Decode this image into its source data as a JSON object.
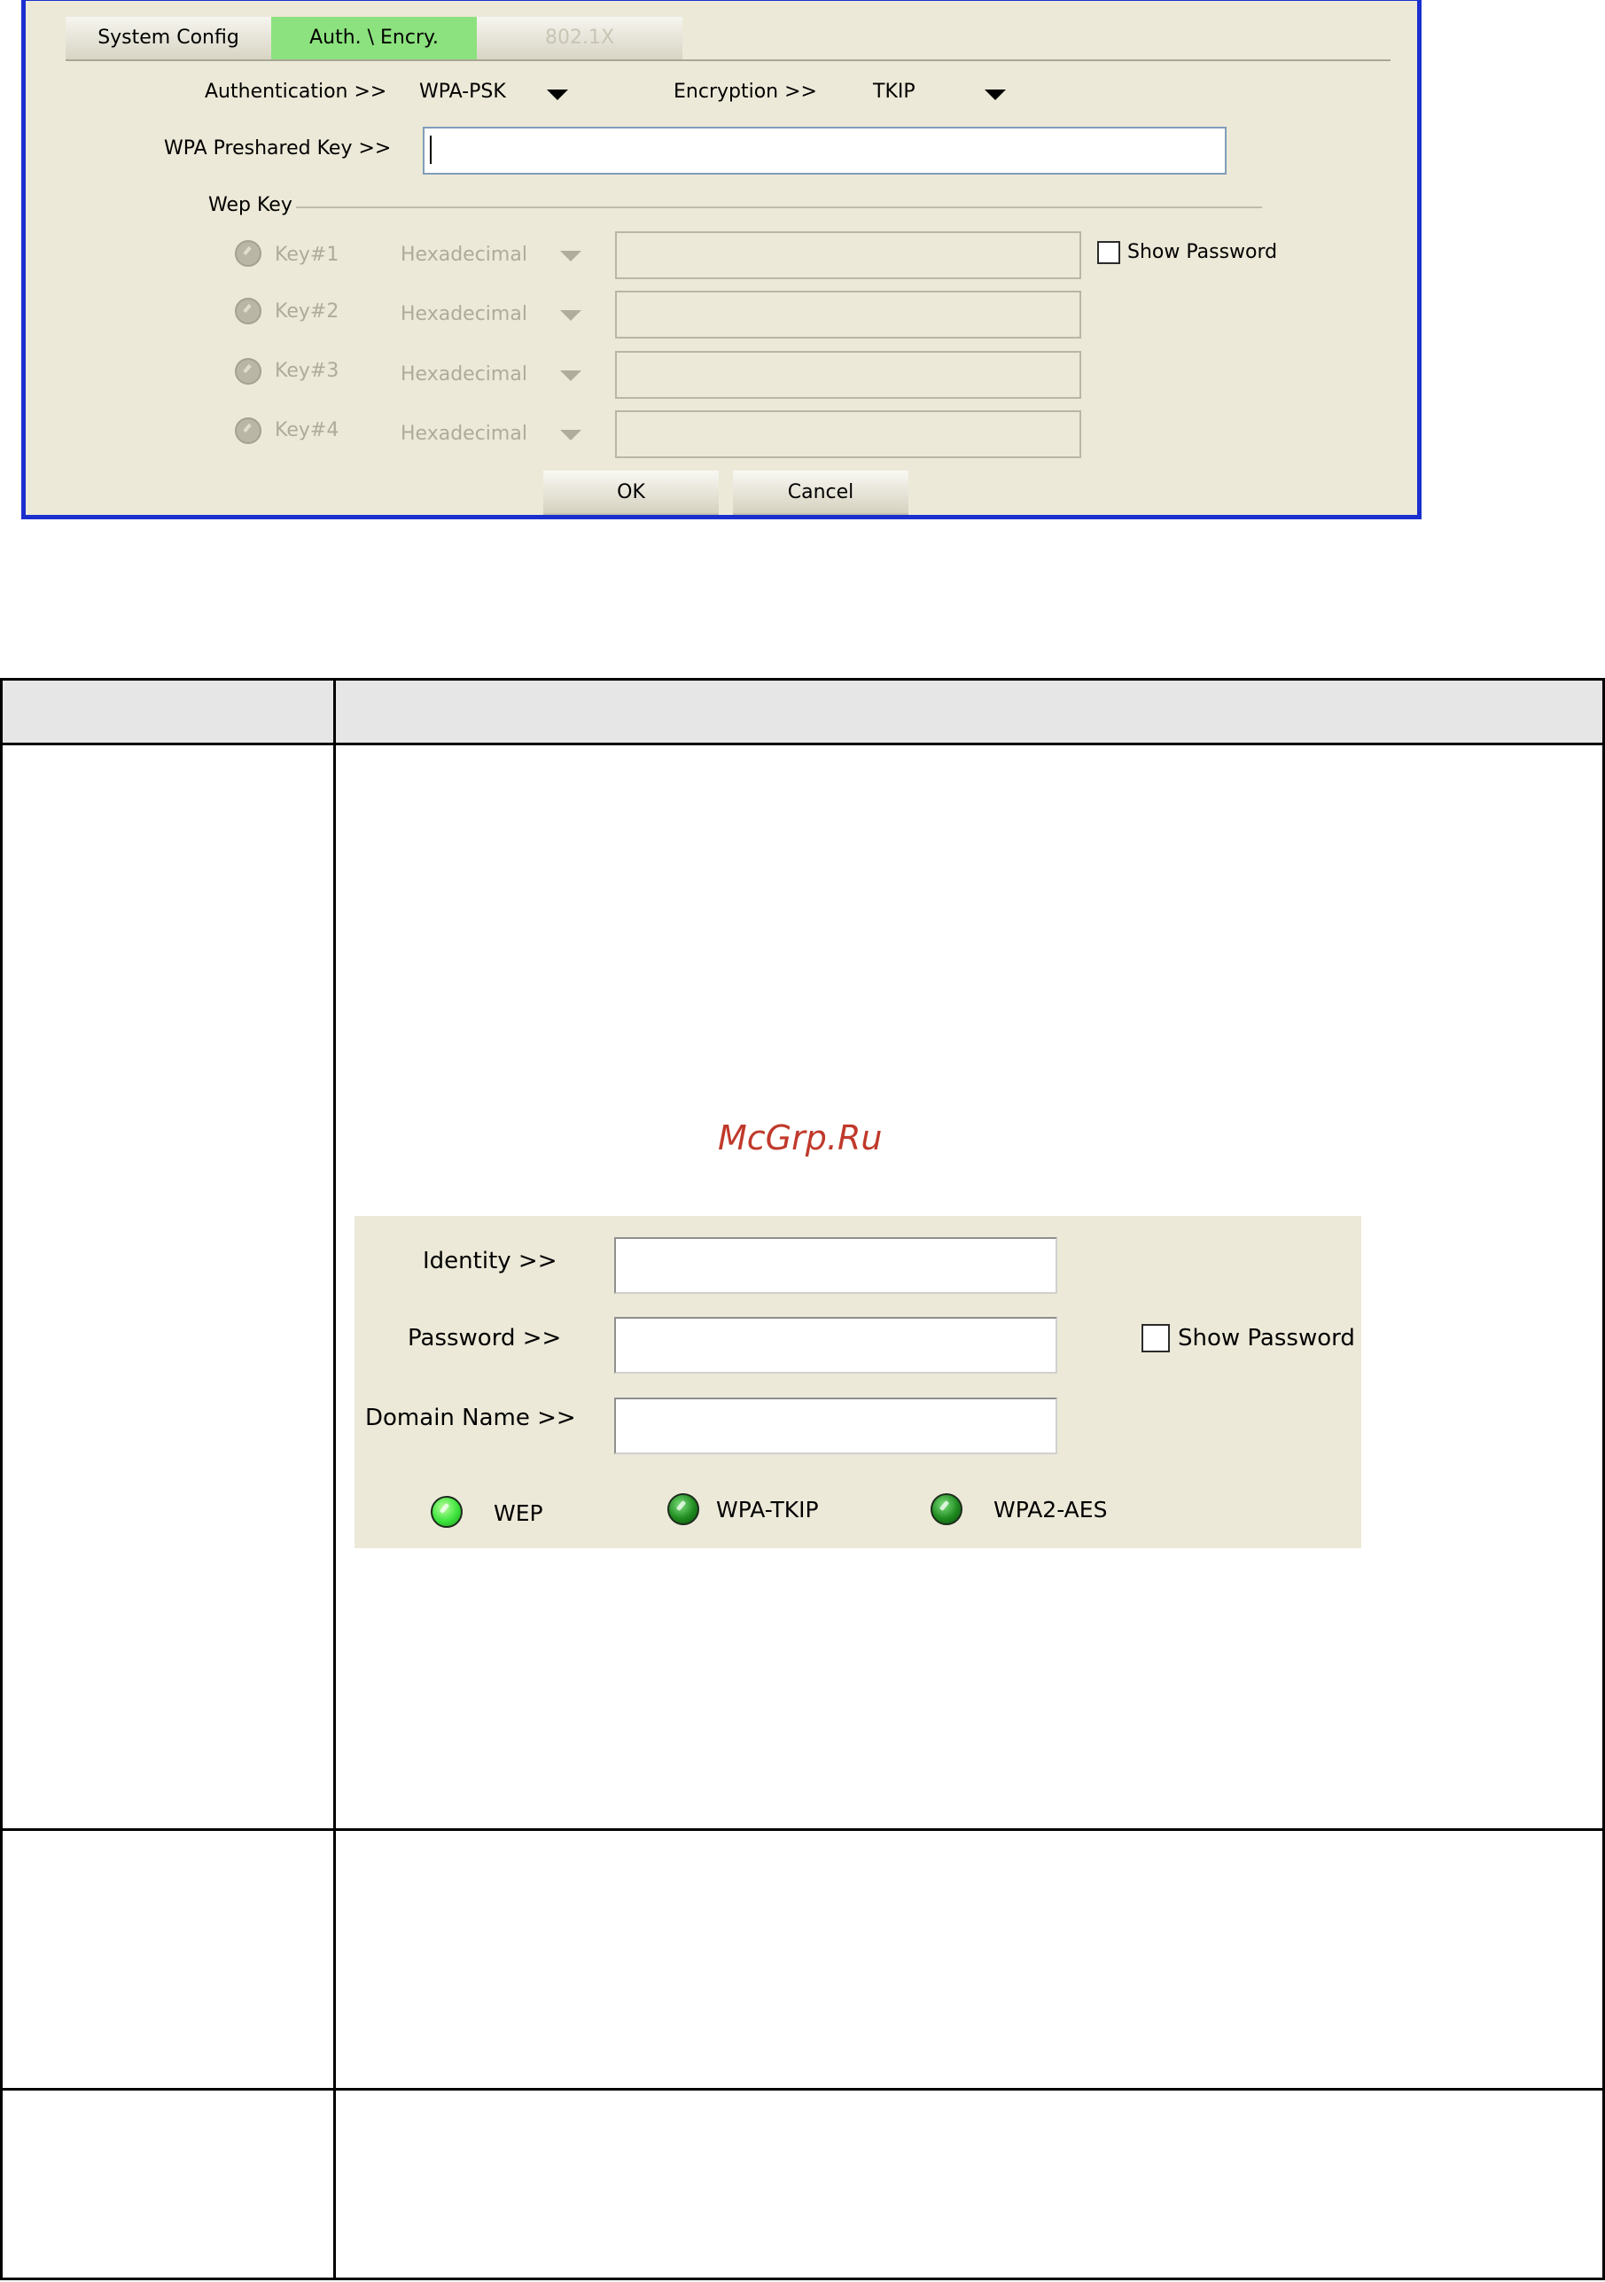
{
  "dialog": {
    "tabs": [
      {
        "label": "System Config"
      },
      {
        "label": "Auth. \\ Encry."
      },
      {
        "label": "802.1X"
      }
    ],
    "authentication_label": "Authentication >>",
    "authentication_value": "WPA-PSK",
    "encryption_label": "Encryption >>",
    "encryption_value": "TKIP",
    "preshared_key_label": "WPA Preshared Key >>",
    "preshared_key_value": "",
    "wep_group_label": "Wep Key",
    "wep_keys": [
      {
        "label": "Key#1",
        "format": "Hexadecimal"
      },
      {
        "label": "Key#2",
        "format": "Hexadecimal"
      },
      {
        "label": "Key#3",
        "format": "Hexadecimal"
      },
      {
        "label": "Key#4",
        "format": "Hexadecimal"
      }
    ],
    "show_password_label": "Show Password",
    "ok_label": "OK",
    "cancel_label": "Cancel"
  },
  "watermark": "McGrp.Ru",
  "panel": {
    "identity_label": "Identity >>",
    "password_label": "Password >>",
    "domain_label": "Domain Name >>",
    "show_password_label": "Show Password",
    "leds": [
      {
        "label": "WEP"
      },
      {
        "label": "WPA-TKIP"
      },
      {
        "label": "WPA2-AES"
      }
    ]
  },
  "colors": {
    "dialog_border": "#1b2fcf",
    "dialog_bg": "#ece9d8",
    "active_tab": "#8ce27e",
    "table_header_bg": "#e6e6e6",
    "watermark": "#c0392b"
  }
}
